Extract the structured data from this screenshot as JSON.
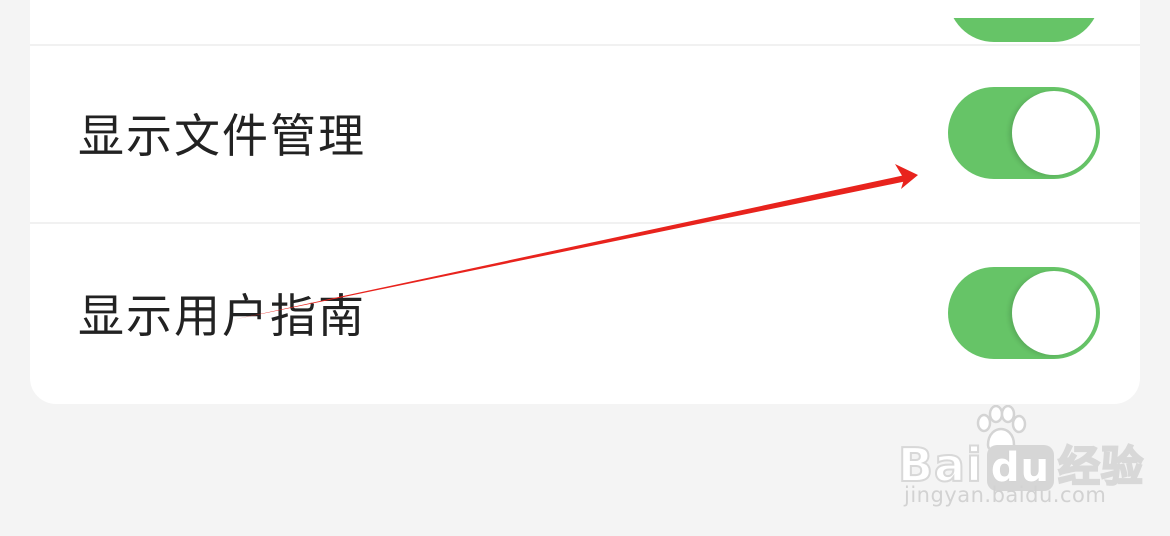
{
  "settings": {
    "rows": [
      {
        "label": "",
        "enabled": true
      },
      {
        "label": "显示文件管理",
        "enabled": true
      },
      {
        "label": "显示用户指南",
        "enabled": true
      }
    ]
  },
  "annotation": {
    "arrow_color": "#e8231d"
  },
  "watermark": {
    "logo_bai": "Bai",
    "logo_du": "du",
    "logo_jingyan": "经验",
    "url": "jingyan.baidu.com"
  },
  "colors": {
    "toggle_on": "#66c467",
    "card": "#ffffff",
    "background": "#f4f4f4",
    "text": "#222222"
  }
}
